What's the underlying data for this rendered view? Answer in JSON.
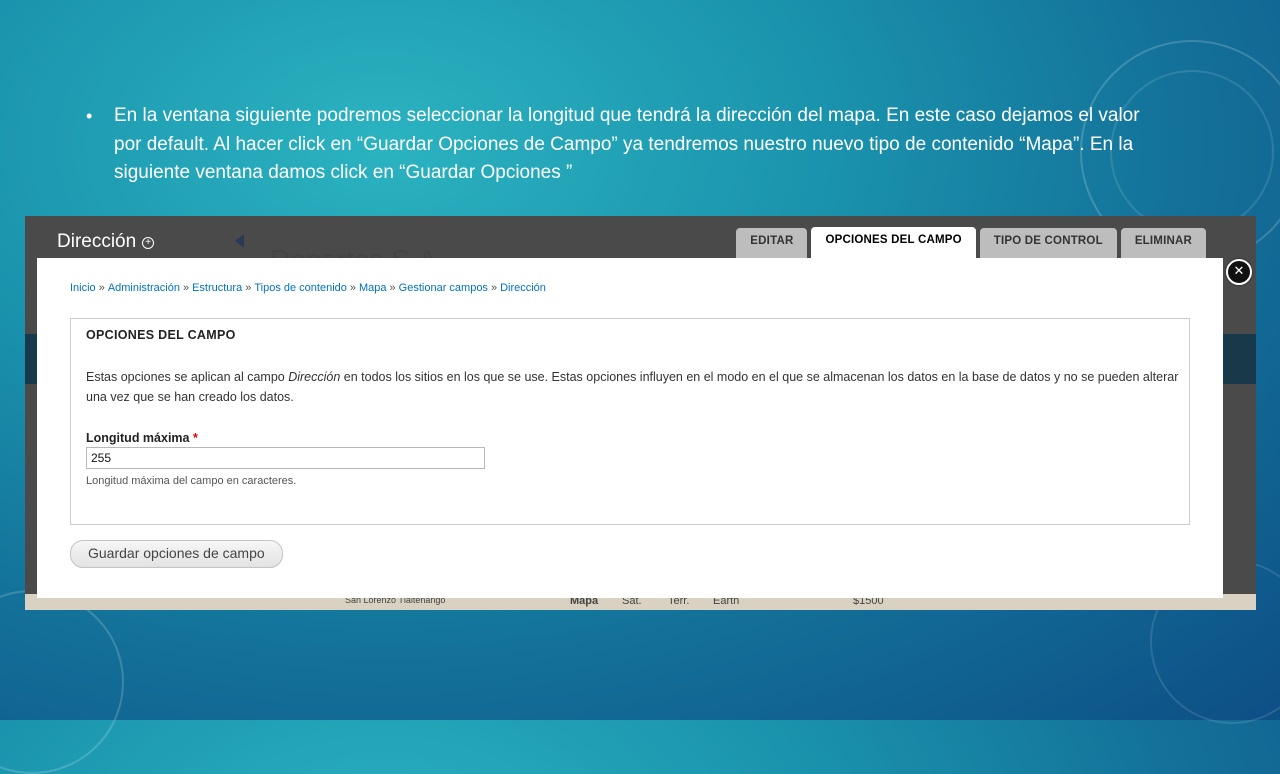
{
  "slide": {
    "bullet": "•",
    "text": "En la ventana siguiente podremos seleccionar la longitud que tendrá la dirección del mapa. En este caso dejamos el valor por default. Al hacer click en “Guardar Opciones de Campo” ya tendremos nuestro nuevo tipo de contenido “Mapa”. En la siguiente ventana damos click en  “Guardar Opciones ”"
  },
  "background_page": {
    "title": "Dirección",
    "title_icon": "plus-circle-icon",
    "behind_text": "Deportes S.A.",
    "bottom_items": [
      "San Lorenzo Tlaltenango",
      "Mapa",
      "Sat.",
      "Terr.",
      "Earth",
      "$1500"
    ]
  },
  "tabs": [
    {
      "label": "EDITAR",
      "active": false
    },
    {
      "label": "OPCIONES DEL CAMPO",
      "active": true
    },
    {
      "label": "TIPO DE CONTROL",
      "active": false
    },
    {
      "label": "ELIMINAR",
      "active": false
    }
  ],
  "dialog": {
    "close_icon": "close-icon",
    "breadcrumb": [
      "Inicio",
      "Administración",
      "Estructura",
      "Tipos de contenido",
      "Mapa",
      "Gestionar campos",
      "Dirección"
    ],
    "breadcrumb_separator": "»",
    "fieldset_title": "OPCIONES DEL CAMPO",
    "description_before": "Estas opciones se aplican al campo ",
    "description_field": "Dirección",
    "description_after": " en todos los sitios en los que se use. Estas opciones influyen en el modo en el que se almacenan los datos en la base de datos y no se pueden alterar una vez que se han creado los datos.",
    "field_label": "Longitud máxima",
    "required_mark": "*",
    "field_value": "255",
    "field_help": "Longitud máxima del campo en caracteres.",
    "save_button": "Guardar opciones de campo"
  },
  "colors": {
    "link": "#0074bd",
    "required": "#e00000",
    "tab_inactive": "#bdbdbd",
    "overlay": "#4a4a4a"
  }
}
